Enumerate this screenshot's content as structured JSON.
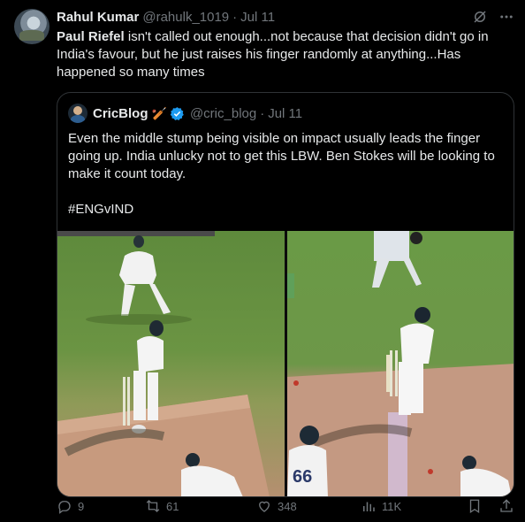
{
  "tweet": {
    "author_name": "Rahul Kumar",
    "author_handle": "@rahulk_1019",
    "date": "Jul 11",
    "text_bold": "Paul Riefel",
    "text_rest": " isn't called out enough...not because that decision didn't go in India's favour, but he just raises his finger randomly at anything...Has happened so many times"
  },
  "quote": {
    "author_name": "CricBlog",
    "emoji": "🏏",
    "author_handle": "@cric_blog",
    "date": "Jul 11",
    "text": "Even the middle stump being visible on impact usually leads the finger going up. India unlucky not to get this LBW. Ben Stokes will be looking to make it count today.",
    "hashtag": "#ENGvIND",
    "jersey_number": "66"
  },
  "actions": {
    "replies": "9",
    "retweets": "61",
    "likes": "348",
    "views": "11K"
  },
  "colors": {
    "background": "#000000",
    "text": "#e7e9ea",
    "muted": "#71767b",
    "border": "#2f3336",
    "verified": "#1d9bf0"
  }
}
